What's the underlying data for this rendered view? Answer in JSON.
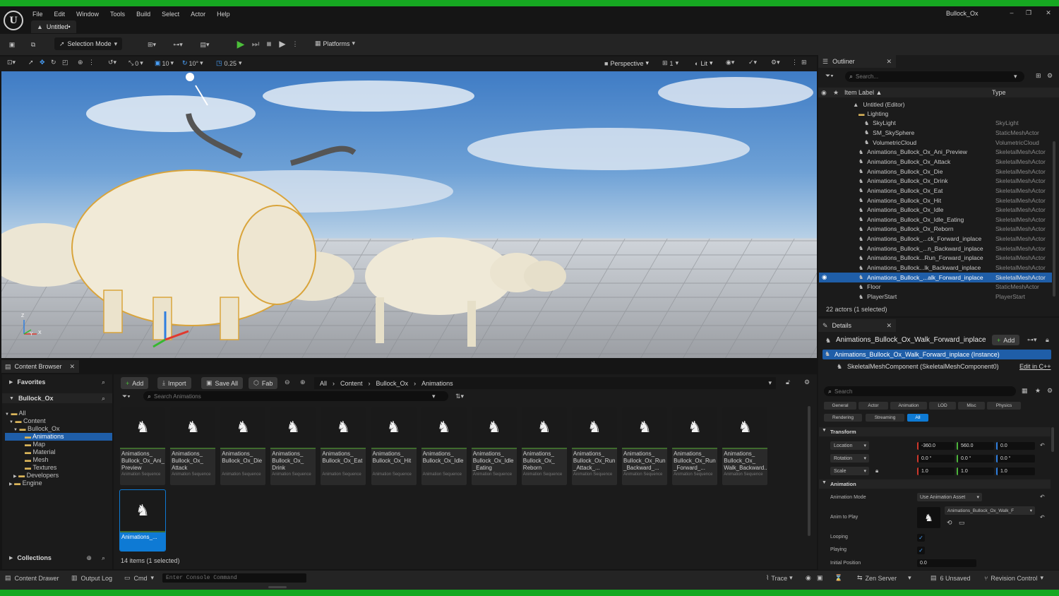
{
  "window": {
    "title": "Bullock_Ox",
    "tab": "Untitled•"
  },
  "menu": [
    "File",
    "Edit",
    "Window",
    "Tools",
    "Build",
    "Select",
    "Actor",
    "Help"
  ],
  "toolbar": {
    "mode": "Selection Mode",
    "platforms": "Platforms"
  },
  "viewport": {
    "translate_snap": "0",
    "rotate_step": "10",
    "grid": "10°",
    "scale": "0.25",
    "perspective": "Perspective",
    "camera_speed": "1",
    "view_mode": "Lit",
    "axis_x": "X",
    "axis_y": "Y",
    "axis_z": "Z"
  },
  "outliner": {
    "title": "Outliner",
    "search_placeholder": "Search...",
    "col_label": "Item Label ▲",
    "col_type": "Type",
    "world": "Untitled (Editor)",
    "folder": "Lighting",
    "items": [
      {
        "label": "SkyLight",
        "type": "SkyLight"
      },
      {
        "label": "SM_SkySphere",
        "type": "StaticMeshActor"
      },
      {
        "label": "VolumetricCloud",
        "type": "VolumetricCloud"
      },
      {
        "label": "Animations_Bullock_Ox_Ani_Preview",
        "type": "SkeletalMeshActor"
      },
      {
        "label": "Animations_Bullock_Ox_Attack",
        "type": "SkeletalMeshActor"
      },
      {
        "label": "Animations_Bullock_Ox_Die",
        "type": "SkeletalMeshActor"
      },
      {
        "label": "Animations_Bullock_Ox_Drink",
        "type": "SkeletalMeshActor"
      },
      {
        "label": "Animations_Bullock_Ox_Eat",
        "type": "SkeletalMeshActor"
      },
      {
        "label": "Animations_Bullock_Ox_Hit",
        "type": "SkeletalMeshActor"
      },
      {
        "label": "Animations_Bullock_Ox_Idle",
        "type": "SkeletalMeshActor"
      },
      {
        "label": "Animations_Bullock_Ox_Idle_Eating",
        "type": "SkeletalMeshActor"
      },
      {
        "label": "Animations_Bullock_Ox_Reborn",
        "type": "SkeletalMeshActor"
      },
      {
        "label": "Animations_Bullock_...ck_Forward_inplace",
        "type": "SkeletalMeshActor"
      },
      {
        "label": "Animations_Bullock_...n_Backward_inplace",
        "type": "SkeletalMeshActor"
      },
      {
        "label": "Animations_Bullock...Run_Forward_inplace",
        "type": "SkeletalMeshActor"
      },
      {
        "label": "Animations_Bullock...lk_Backward_inplace",
        "type": "SkeletalMeshActor"
      },
      {
        "label": "Animations_Bullock_...alk_Forward_inplace",
        "type": "SkeletalMeshActor"
      },
      {
        "label": "Floor",
        "type": "StaticMeshActor"
      },
      {
        "label": "PlayerStart",
        "type": "PlayerStart"
      }
    ],
    "status": "22 actors (1 selected)"
  },
  "details": {
    "title": "Details",
    "actor": "Animations_Bullock_Ox_Walk_Forward_inplace",
    "add": "Add",
    "instance": "Animations_Bullock_Ox_Walk_Forward_inplace (Instance)",
    "component": "SkeletalMeshComponent (SkeletalMeshComponent0)",
    "edit_cpp": "Edit in C++",
    "search_placeholder": "Search",
    "filters": [
      "General",
      "Actor",
      "Animation",
      "LOD",
      "Misc",
      "Physics",
      "Rendering",
      "Streaming",
      "All"
    ],
    "transform_header": "Transform",
    "location_label": "Location",
    "loc_x": "-360.0",
    "loc_y": "560.0",
    "loc_z": "0.0",
    "rotation_label": "Rotation",
    "rot_x": "0.0 °",
    "rot_y": "0.0 °",
    "rot_z": "0.0 °",
    "scale_label": "Scale",
    "scale_x": "1.0",
    "scale_y": "1.0",
    "scale_z": "1.0",
    "animation_header": "Animation",
    "anim_mode_label": "Animation Mode",
    "anim_mode": "Use Animation Asset",
    "anim_to_play_label": "Anim to Play",
    "anim_to_play": "Animations_Bullock_Ox_Walk_F",
    "looping_label": "Looping",
    "playing_label": "Playing",
    "init_pos_label": "Initial Position",
    "init_pos": "0.0"
  },
  "content_browser": {
    "tab": "Content Browser",
    "favorites": "Favorites",
    "project": "Bullock_Ox",
    "add": "Add",
    "import": "Import",
    "save_all": "Save All",
    "fab": "Fab",
    "path": [
      "All",
      "Content",
      "Bullock_Ox",
      "Animations"
    ],
    "search_placeholder": "Search Animations",
    "tree": [
      "All",
      "Content",
      "Bullock_Ox",
      "Animations",
      "Map",
      "Material",
      "Mesh",
      "Textures",
      "Developers",
      "Engine"
    ],
    "collections": "Collections",
    "asset_type": "Animation Sequence",
    "assets": [
      "Animations_ Bullock_Ox_Ani_ Preview",
      "Animations_ Bullock_Ox_ Attack",
      "Animations_ Bullock_Ox_Die",
      "Animations_ Bullock_Ox_ Drink",
      "Animations_ Bullock_Ox_Eat",
      "Animations_ Bullock_Ox_Hit",
      "Animations_ Bullock_Ox_Idle",
      "Animations_ Bullock_Ox_Idle _Eating",
      "Animations_ Bullock_Ox_ Reborn",
      "Animations_ Bullock_Ox_Run _Attack_...",
      "Animations_ Bullock_Ox_Run _Backward_...",
      "Animations_ Bullock_Ox_Run _Forward_...",
      "Animations_ Bullock_Ox_ Walk_Backward...",
      "Animations_..."
    ],
    "status": "14 items (1 selected)"
  },
  "statusbar": {
    "content_drawer": "Content Drawer",
    "output_log": "Output Log",
    "cmd": "Cmd",
    "console_placeholder": "Enter Console Command",
    "trace": "Trace",
    "zen": "Zen Server",
    "unsaved": "6 Unsaved",
    "revision": "Revision Control"
  },
  "colors": {
    "accent": "#0e7ad4",
    "selection": "#1f5ea8",
    "green_frame": "#16a821",
    "viewport_sky": "#5f94cf"
  }
}
